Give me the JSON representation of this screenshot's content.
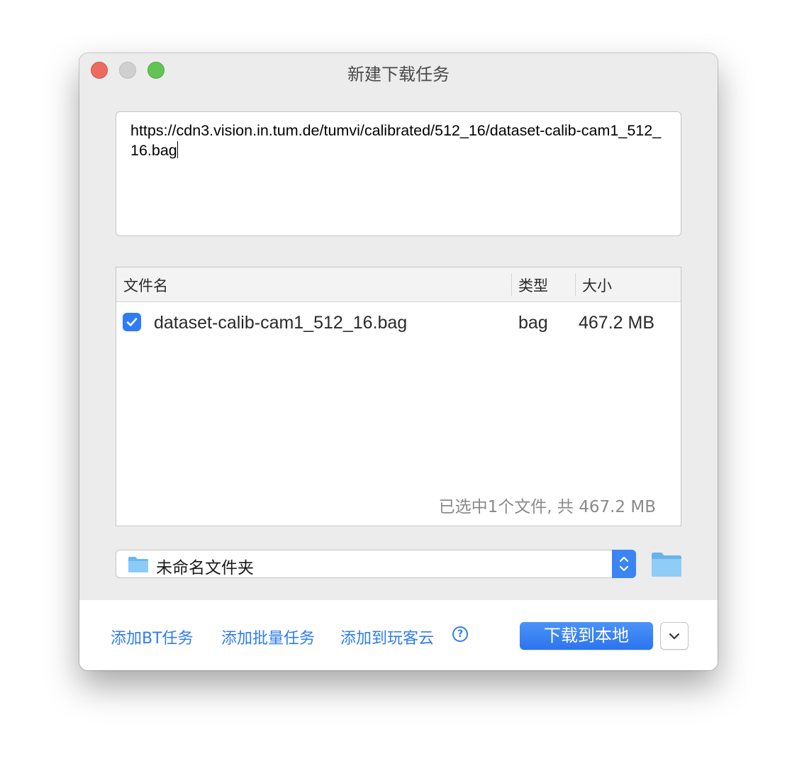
{
  "window": {
    "title": "新建下载任务"
  },
  "url_input": {
    "value": "https://cdn3.vision.in.tum.de/tumvi/calibrated/512_16/dataset-calib-cam1_512_16.bag"
  },
  "file_table": {
    "columns": [
      "文件名",
      "类型",
      "大小"
    ],
    "rows": [
      {
        "checked": true,
        "name": "dataset-calib-cam1_512_16.bag",
        "type": "bag",
        "size": "467.2 MB"
      }
    ],
    "summary": "已选中1个文件, 共 467.2 MB"
  },
  "destination": {
    "folder": "未命名文件夹"
  },
  "footer": {
    "add_bt": "添加BT任务",
    "add_batch": "添加批量任务",
    "add_cloud": "添加到玩客云",
    "help_symbol": "?",
    "download_local": "下载到本地"
  },
  "icons": {
    "help": "question-circle-icon",
    "folder": "folder-icon",
    "dropdown": "chevron-down-icon",
    "stepper": "up-down-chevron-icon",
    "check": "checkmark-icon"
  },
  "colors": {
    "accent": "#2e7cf6",
    "close": "#ed6a5e",
    "zoom": "#61c454",
    "window_bg": "#ececec"
  }
}
